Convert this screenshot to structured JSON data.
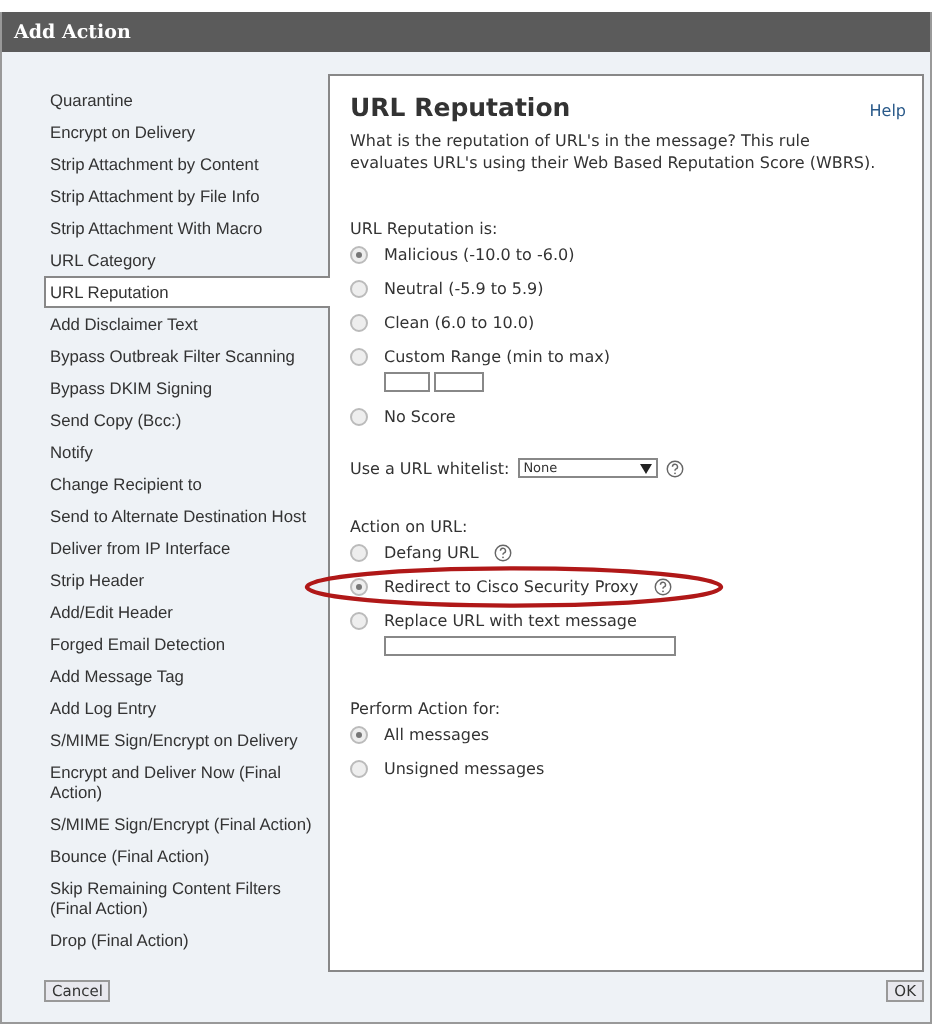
{
  "window": {
    "title": "Add Action"
  },
  "actions": [
    {
      "label": "Quarantine",
      "selected": false
    },
    {
      "label": "Encrypt on Delivery",
      "selected": false
    },
    {
      "label": "Strip Attachment by Content",
      "selected": false
    },
    {
      "label": "Strip Attachment by File Info",
      "selected": false
    },
    {
      "label": "Strip Attachment With Macro",
      "selected": false
    },
    {
      "label": "URL Category",
      "selected": false
    },
    {
      "label": "URL Reputation",
      "selected": true
    },
    {
      "label": "Add Disclaimer Text",
      "selected": false
    },
    {
      "label": "Bypass Outbreak Filter Scanning",
      "selected": false
    },
    {
      "label": "Bypass DKIM Signing",
      "selected": false
    },
    {
      "label": "Send Copy (Bcc:)",
      "selected": false
    },
    {
      "label": "Notify",
      "selected": false
    },
    {
      "label": "Change Recipient to",
      "selected": false
    },
    {
      "label": "Send to Alternate Destination Host",
      "selected": false
    },
    {
      "label": "Deliver from IP Interface",
      "selected": false
    },
    {
      "label": "Strip Header",
      "selected": false
    },
    {
      "label": "Add/Edit Header",
      "selected": false
    },
    {
      "label": "Forged Email Detection",
      "selected": false
    },
    {
      "label": "Add Message Tag",
      "selected": false
    },
    {
      "label": "Add Log Entry",
      "selected": false
    },
    {
      "label": "S/MIME Sign/Encrypt on Delivery",
      "selected": false
    },
    {
      "label": "Encrypt and Deliver Now (Final Action)",
      "selected": false
    },
    {
      "label": "S/MIME Sign/Encrypt (Final Action)",
      "selected": false
    },
    {
      "label": "Bounce (Final Action)",
      "selected": false
    },
    {
      "label": "Skip Remaining Content Filters (Final Action)",
      "selected": false
    },
    {
      "label": "Drop (Final Action)",
      "selected": false
    }
  ],
  "panel": {
    "title": "URL Reputation",
    "help": "Help",
    "description": "What is the reputation of URL's in the message? This rule evaluates URL's using their Web Based Reputation Score (WBRS).",
    "reputation": {
      "label": "URL Reputation is:",
      "options": [
        {
          "label": "Malicious (-10.0 to -6.0)",
          "selected": true,
          "kind": "plain"
        },
        {
          "label": "Neutral (-5.9 to 5.9)",
          "selected": false,
          "kind": "plain"
        },
        {
          "label": "Clean (6.0 to 10.0)",
          "selected": false,
          "kind": "plain"
        },
        {
          "label": "Custom Range (min to max)",
          "selected": false,
          "kind": "range"
        },
        {
          "label": "No Score",
          "selected": false,
          "kind": "plain"
        }
      ]
    },
    "whitelist": {
      "label": "Use a URL whitelist:",
      "value": "None"
    },
    "action": {
      "label": "Action on URL:",
      "options": [
        {
          "label": "Defang URL",
          "selected": false,
          "kind": "help",
          "highlighted": false
        },
        {
          "label": "Redirect to Cisco Security Proxy",
          "selected": true,
          "kind": "help",
          "highlighted": true
        },
        {
          "label": "Replace URL with text message",
          "selected": false,
          "kind": "text",
          "highlighted": false
        }
      ]
    },
    "perform": {
      "label": "Perform Action for:",
      "options": [
        {
          "label": "All messages",
          "selected": true,
          "kind": "plain"
        },
        {
          "label": "Unsigned messages",
          "selected": false,
          "kind": "plain"
        }
      ]
    }
  },
  "buttons": {
    "cancel": "Cancel",
    "ok": "OK"
  }
}
